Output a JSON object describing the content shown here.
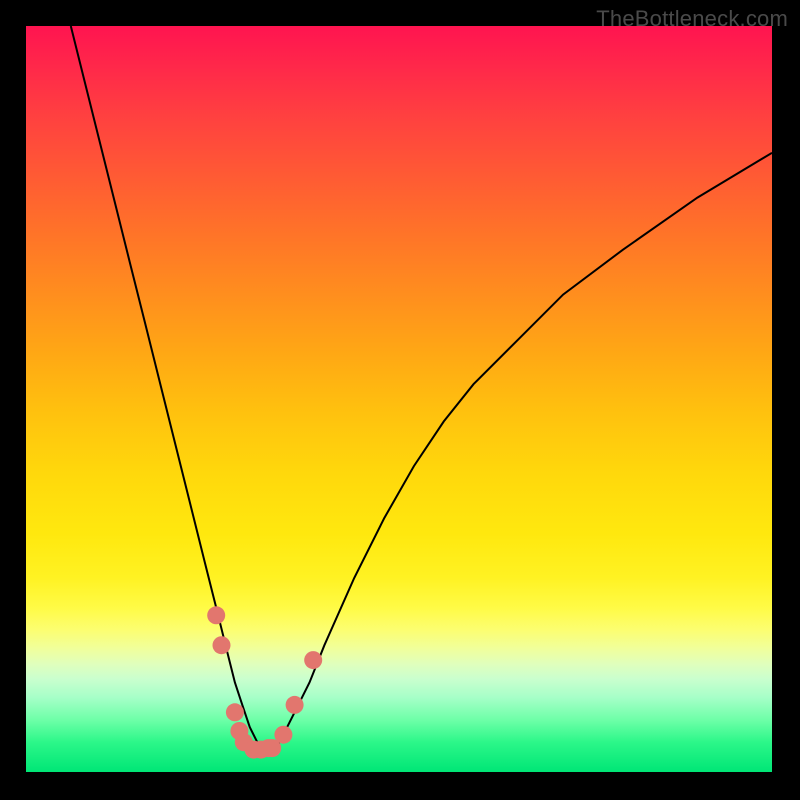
{
  "watermark": "TheBottleneck.com",
  "chart_data": {
    "type": "line",
    "title": "",
    "xlabel": "",
    "ylabel": "",
    "xlim": [
      0,
      100
    ],
    "ylim": [
      0,
      100
    ],
    "series": [
      {
        "name": "bottleneck-curve",
        "x": [
          6,
          8,
          10,
          12,
          14,
          16,
          18,
          20,
          22,
          24,
          26,
          27,
          28,
          29,
          30,
          31,
          32,
          33,
          34,
          35,
          36,
          38,
          40,
          44,
          48,
          52,
          56,
          60,
          66,
          72,
          80,
          90,
          100
        ],
        "y": [
          100,
          92,
          84,
          76,
          68,
          60,
          52,
          44,
          36,
          28,
          20,
          16,
          12,
          9,
          6,
          4,
          3,
          3,
          4,
          6,
          8,
          12,
          17,
          26,
          34,
          41,
          47,
          52,
          58,
          64,
          70,
          77,
          83
        ]
      }
    ],
    "markers": {
      "name": "highlight-points",
      "color": "#e2766e",
      "points": [
        {
          "x": 25.5,
          "y": 21
        },
        {
          "x": 26.2,
          "y": 17
        },
        {
          "x": 28.0,
          "y": 8
        },
        {
          "x": 28.6,
          "y": 5.5
        },
        {
          "x": 29.2,
          "y": 4
        },
        {
          "x": 30.5,
          "y": 3
        },
        {
          "x": 31.5,
          "y": 3
        },
        {
          "x": 32.5,
          "y": 3.2
        },
        {
          "x": 33.0,
          "y": 3.2
        },
        {
          "x": 34.5,
          "y": 5
        },
        {
          "x": 36.0,
          "y": 9
        },
        {
          "x": 38.5,
          "y": 15
        }
      ]
    },
    "gradient_stops": [
      {
        "pos": 0.0,
        "color": "#ff1450"
      },
      {
        "pos": 0.5,
        "color": "#ffd80c"
      },
      {
        "pos": 0.8,
        "color": "#fffb46"
      },
      {
        "pos": 1.0,
        "color": "#00e676"
      }
    ]
  }
}
